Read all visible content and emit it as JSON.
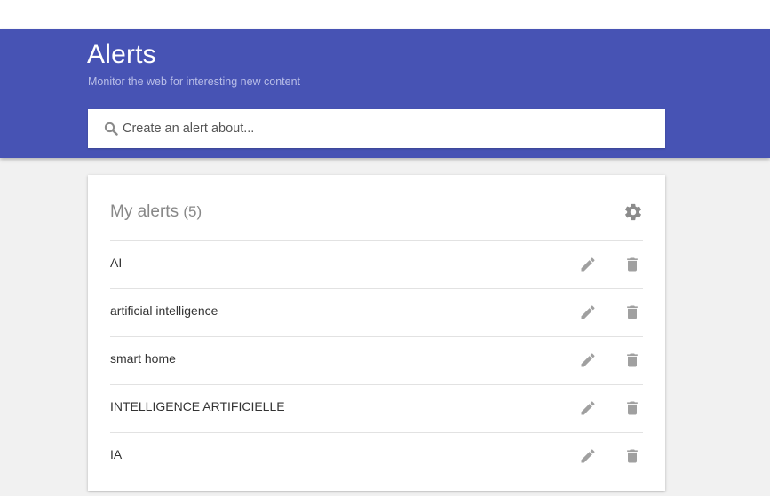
{
  "header": {
    "title": "Alerts",
    "subtitle": "Monitor the web for interesting new content",
    "background_color": "#4753b4"
  },
  "search": {
    "placeholder": "Create an alert about...",
    "value": "",
    "icon": "search-icon"
  },
  "alerts_card": {
    "title": "My alerts",
    "count": "(5)",
    "settings_icon": "gear-icon",
    "items": [
      {
        "label": "AI",
        "edit_icon": "pencil-icon",
        "delete_icon": "trash-icon"
      },
      {
        "label": "artificial intelligence",
        "edit_icon": "pencil-icon",
        "delete_icon": "trash-icon"
      },
      {
        "label": "smart home",
        "edit_icon": "pencil-icon",
        "delete_icon": "trash-icon"
      },
      {
        "label": "INTELLIGENCE ARTIFICIELLE",
        "edit_icon": "pencil-icon",
        "delete_icon": "trash-icon"
      },
      {
        "label": "IA",
        "edit_icon": "pencil-icon",
        "delete_icon": "trash-icon"
      }
    ]
  }
}
